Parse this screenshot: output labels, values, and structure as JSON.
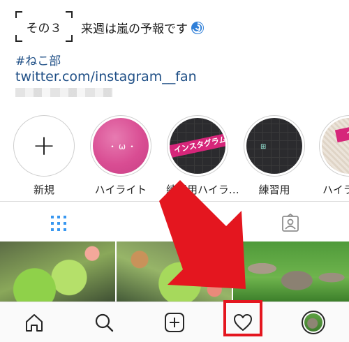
{
  "bio": {
    "step_label": "その３",
    "forecast": "来週は嵐の予報です",
    "hashtag": "#ねこ部",
    "link": "twitter.com/instagram__fan"
  },
  "highlights": [
    {
      "label": "新規",
      "type": "new",
      "icon": "plus-icon"
    },
    {
      "label": "ハイライト",
      "type": "pink"
    },
    {
      "label": "練習用ハイラ…",
      "type": "dark-band",
      "band": "インスタグラム"
    },
    {
      "label": "練習用",
      "type": "dark"
    },
    {
      "label": "ハイラ",
      "type": "paper-band",
      "band": "インスタ"
    }
  ],
  "tabs": [
    {
      "name": "grid-view-icon",
      "active": true
    },
    {
      "name": "tagged-icon",
      "active": false
    }
  ],
  "bottom_nav": [
    {
      "name": "home-icon"
    },
    {
      "name": "search-icon"
    },
    {
      "name": "new-post-icon"
    },
    {
      "name": "activity-heart-icon",
      "highlighted": true
    },
    {
      "name": "profile-avatar"
    }
  ],
  "colors": {
    "link": "#1f4f86",
    "annotation_red": "#e4161f",
    "active_tab": "#3897f0",
    "highlight_band": "#d6267a"
  }
}
